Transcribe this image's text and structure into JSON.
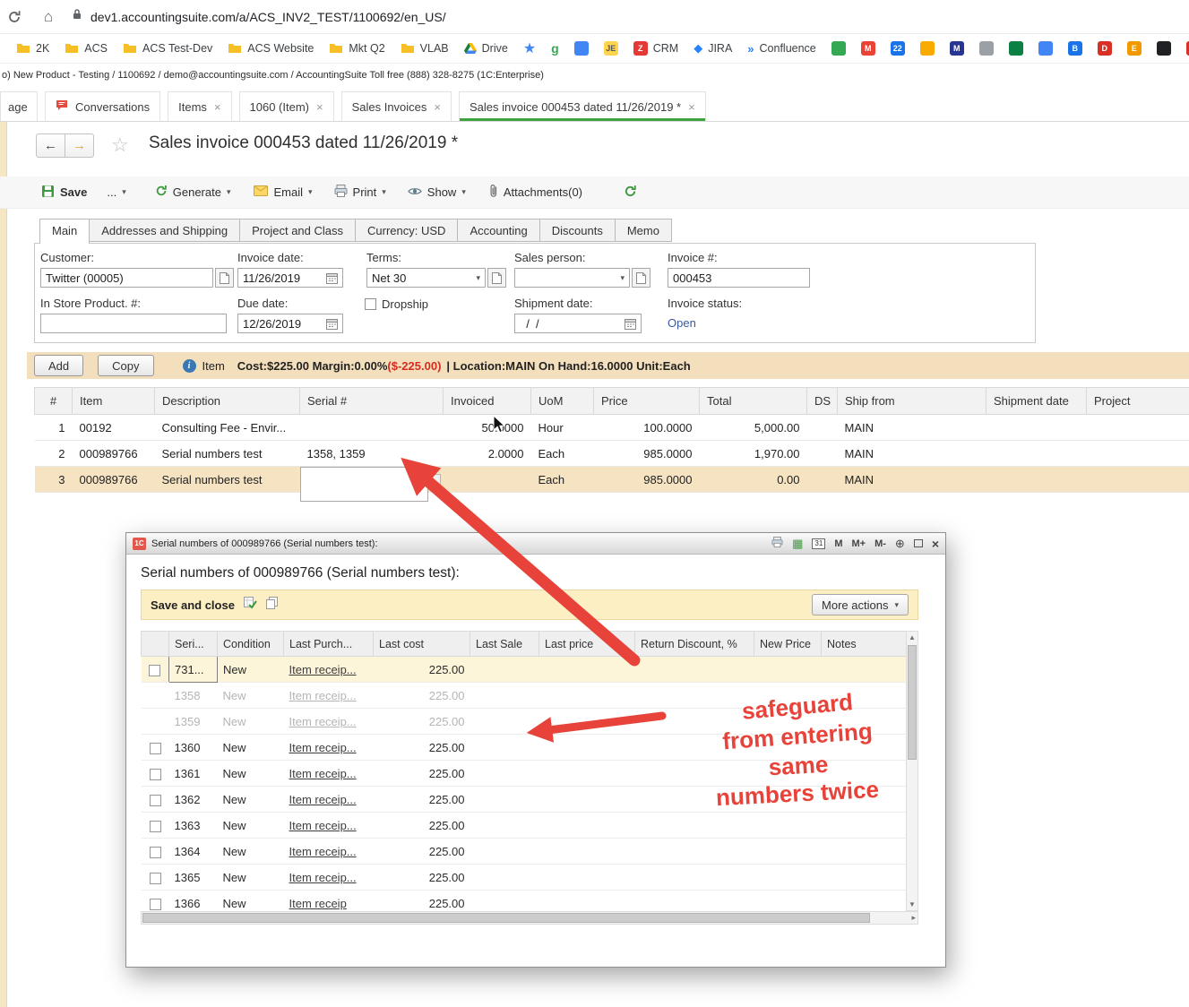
{
  "icons": {
    "caret": "▾",
    "close": "×",
    "back": "←",
    "forward": "→",
    "star": "☆",
    "bm_star": "★",
    "home": "⌂",
    "up": "▲",
    "down": "▼",
    "right": "▸",
    "grid": "▦",
    "magnify": "⊕",
    "info": "i",
    "one_c": "1C",
    "m": "M",
    "m_plus": "M+",
    "m_minus": "M-",
    "diamond": "◆",
    "confluence": "»",
    "g": "g",
    "cal": "31"
  },
  "browser": {
    "url": "dev1.accountingsuite.com/a/ACS_INV2_TEST/1100692/en_US/",
    "bookmarks": [
      "2K",
      "ACS",
      "ACS Test-Dev",
      "ACS Website",
      "Mkt Q2",
      "VLAB",
      "Drive",
      "g",
      "CRM",
      "JIRA",
      "Confluence"
    ],
    "chips": [
      "",
      "M",
      "22",
      "",
      "M",
      "",
      "",
      "",
      "B",
      "D",
      "E",
      "",
      "A"
    ],
    "chip_je": "JE",
    "chip_z": "Z"
  },
  "app_header": "o) New Product - Testing / 1100692 / demo@accountingsuite.com / AccountingSuite Toll free (888) 328-8275   (1C:Enterprise)",
  "tabs": {
    "partial": "age",
    "conversations": "Conversations",
    "items": "Items",
    "item_1060": "1060 (Item)",
    "sales_invoices": "Sales Invoices",
    "active": "Sales invoice 000453 dated 11/26/2019 *"
  },
  "page": {
    "title": "Sales invoice 000453 dated 11/26/2019 *",
    "toolbar": {
      "save": "Save",
      "more": "...",
      "generate": "Generate",
      "email": "Email",
      "print": "Print",
      "show": "Show",
      "attachments": "Attachments(0)"
    },
    "form_tabs": [
      "Main",
      "Addresses and Shipping",
      "Project and Class",
      "Currency: USD",
      "Accounting",
      "Discounts",
      "Memo"
    ],
    "fields": {
      "customer": {
        "label": "Customer:",
        "value": "Twitter (00005)"
      },
      "invoice_date": {
        "label": "Invoice date:",
        "value": "11/26/2019"
      },
      "terms": {
        "label": "Terms:",
        "value": "Net 30"
      },
      "sales_person": {
        "label": "Sales person:",
        "value": ""
      },
      "invoice_number": {
        "label": "Invoice #:",
        "value": "000453"
      },
      "in_store": {
        "label": "In Store Product. #:",
        "value": ""
      },
      "due_date": {
        "label": "Due date:",
        "value": "12/26/2019"
      },
      "dropship": {
        "label": "Dropship"
      },
      "shipment_date": {
        "label": "Shipment date:",
        "value": "  /  /"
      },
      "invoice_status": {
        "label": "Invoice status:",
        "value": "Open"
      }
    },
    "buttons": {
      "add": "Add",
      "copy": "Copy"
    },
    "item_info": {
      "label": "Item",
      "cost_margin": "Cost:$225.00 Margin:0.00%",
      "loss": "($-225.00)",
      "location": "| Location:MAIN On Hand:16.0000 Unit:Each"
    },
    "table": {
      "columns": [
        "#",
        "Item",
        "Description",
        "Serial #",
        "Invoiced",
        "UoM",
        "Price",
        "Total",
        "DS",
        "Ship from",
        "Shipment date",
        "Project"
      ],
      "rows": [
        {
          "n": "1",
          "item": "00192",
          "desc": "Consulting Fee - Envir...",
          "serial": "",
          "qty": "50.0000",
          "uom": "Hour",
          "price": "100.0000",
          "total": "5,000.00",
          "ship": "MAIN"
        },
        {
          "n": "2",
          "item": "000989766",
          "desc": "Serial numbers test",
          "serial": "1358, 1359",
          "qty": "2.0000",
          "uom": "Each",
          "price": "985.0000",
          "total": "1,970.00",
          "ship": "MAIN"
        },
        {
          "n": "3",
          "item": "000989766",
          "desc": "Serial numbers test",
          "serial": "",
          "qty": "",
          "uom": "Each",
          "price": "985.0000",
          "total": "0.00",
          "ship": "MAIN"
        }
      ]
    }
  },
  "modal": {
    "titlebar": "Serial numbers of 000989766 (Serial numbers test):",
    "heading": "Serial numbers of 000989766 (Serial numbers test):",
    "save_close": "Save and close",
    "more_actions": "More actions",
    "grid": {
      "columns": [
        "",
        "Seri...",
        "Condition",
        "Last Purch...",
        "Last cost",
        "Last Sale",
        "Last price",
        "Return Discount, %",
        "New Price",
        "Notes"
      ],
      "rows": [
        {
          "serial": "731...",
          "cond": "New",
          "purch": "Item receip...",
          "cost": "225.00"
        },
        {
          "serial": "1358",
          "cond": "New",
          "purch": "Item receip...",
          "cost": "225.00"
        },
        {
          "serial": "1359",
          "cond": "New",
          "purch": "Item receip...",
          "cost": "225.00"
        },
        {
          "serial": "1360",
          "cond": "New",
          "purch": "Item receip...",
          "cost": "225.00"
        },
        {
          "serial": "1361",
          "cond": "New",
          "purch": "Item receip...",
          "cost": "225.00"
        },
        {
          "serial": "1362",
          "cond": "New",
          "purch": "Item receip...",
          "cost": "225.00"
        },
        {
          "serial": "1363",
          "cond": "New",
          "purch": "Item receip...",
          "cost": "225.00"
        },
        {
          "serial": "1364",
          "cond": "New",
          "purch": "Item receip...",
          "cost": "225.00"
        },
        {
          "serial": "1365",
          "cond": "New",
          "purch": "Item receip...",
          "cost": "225.00"
        },
        {
          "serial": "1366",
          "cond": "New",
          "purch": "Item receip",
          "cost": "225.00"
        }
      ]
    }
  },
  "annotation": {
    "lines": [
      "safeguard",
      "from entering",
      "same",
      "numbers twice"
    ]
  },
  "colors": {
    "accent_green": "#3da33d",
    "tan_bar": "#f3dfbc",
    "selected_row": "#f6e3c2",
    "annotation_red": "#e8433a",
    "status_link": "#3757a6"
  }
}
